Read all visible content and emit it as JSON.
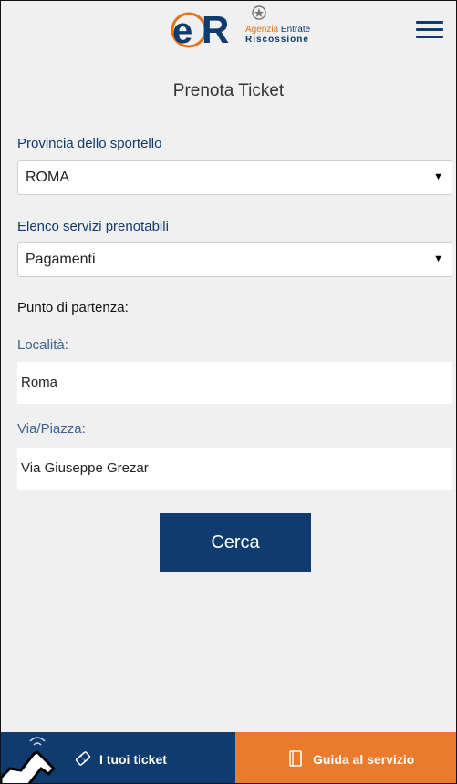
{
  "header": {
    "logo_line1_a": "Agenzia",
    "logo_line1_b": "Entrate",
    "logo_line2": "Riscossione"
  },
  "page": {
    "title": "Prenota Ticket"
  },
  "form": {
    "provincia_label": "Provincia dello sportello",
    "provincia_value": "ROMA",
    "servizi_label": "Elenco servizi prenotabili",
    "servizi_value": "Pagamenti",
    "partenza_label": "Punto di partenza:",
    "localita_label": "Località:",
    "localita_value": "Roma",
    "via_label": "Via/Piazza:",
    "via_value": "Via Giuseppe Grezar",
    "search_button": "Cerca"
  },
  "bottom_nav": {
    "tickets_label": "I tuoi ticket",
    "guide_label": "Guida al servizio"
  },
  "colors": {
    "primary": "#0f3b6e",
    "accent": "#ea7a2c",
    "background": "#f0f0f0"
  }
}
